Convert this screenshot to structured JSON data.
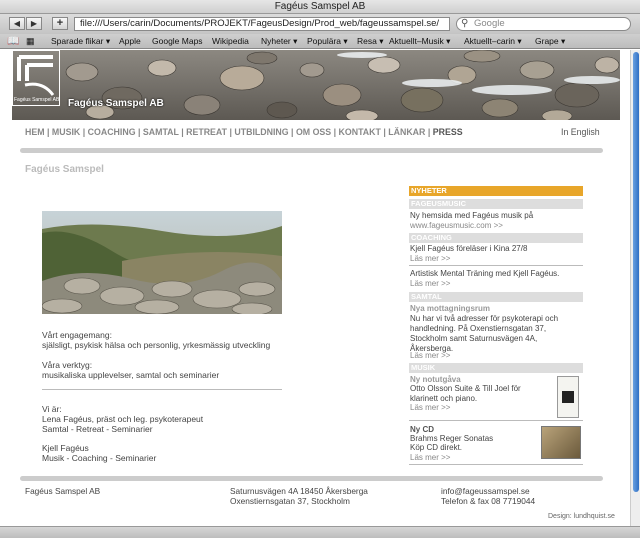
{
  "window": {
    "title": "Fagéus Samspel AB"
  },
  "toolbar": {
    "back": "◀",
    "forward": "▶",
    "add": "+",
    "url": "file:///Users/carin/Documents/PROJEKT/FageusDesign/Prod_web/fageussamspel.se/",
    "search_placeholder": "Google"
  },
  "bookmarks": [
    {
      "label": "Sparade flikar",
      "menu": true
    },
    {
      "label": "Apple",
      "menu": false
    },
    {
      "label": "Google Maps",
      "menu": false
    },
    {
      "label": "Wikipedia",
      "menu": false
    },
    {
      "label": "Nyheter",
      "menu": true
    },
    {
      "label": "Populära",
      "menu": true
    },
    {
      "label": "Resa",
      "menu": true
    },
    {
      "label": "Aktuellt–Musik",
      "menu": true
    },
    {
      "label": "Aktuellt–carin",
      "menu": true
    },
    {
      "label": "Grape",
      "menu": true
    }
  ],
  "banner": {
    "company": "Fagéus Samspel AB",
    "logo_text": "Fagéus Samspel AB"
  },
  "nav": {
    "items": [
      "HEM",
      "MUSIK",
      "COACHING",
      "SAMTAL",
      "RETREAT",
      "UTBILDNING",
      "OM OSS",
      "KONTAKT",
      "LÄNKAR",
      "PRESS"
    ],
    "language": "In English"
  },
  "main": {
    "page_title": "Fagéus Samspel",
    "engagemang_title": "Vårt engagemang:",
    "engagemang_text": "själsligt, psykisk hälsa och personlig, yrkesmässig utveckling",
    "verktyg_title": "Våra verktyg:",
    "verktyg_text": "musikaliska upplevelser, samtal och seminarier",
    "vi_ar": "Vi är:",
    "person1_name": "Lena Fagéus, präst och leg. psykoterapeut",
    "person1_role": "Samtal - Retreat - Seminarier",
    "person2_name": "Kjell Fagéus",
    "person2_role": "Musik - Coaching - Seminarier"
  },
  "sidebar": {
    "nyheter": "NYHETER",
    "fageusmusic": "FAGEUSMUSIC",
    "fm_text": "Ny hemsida med Fagéus musik på",
    "fm_link": "www.fageusmusic.com >>",
    "coaching": "COACHING",
    "c1_text": "Kjell Fagéus föreläser i Kina 27/8",
    "c1_more": "Läs mer >>",
    "c2_text": "Artistisk Mental Träning med Kjell Fagéus.",
    "c2_more": "Läs mer >>",
    "samtal": "SAMTAL",
    "s_sub": "Nya mottagningsrum",
    "s_line1": "Nu har vi två adresser för psykoterapi och",
    "s_line2": "handledning. På Oxenstiernsgatan 37,",
    "s_line3": "Stockholm samt Saturnusvägen 4A,",
    "s_line4": "Åkersberga.",
    "s_more": "Läs mer >>",
    "musik": "MUSIK",
    "m1_sub": "Ny notutgåva",
    "m1_line1": "Otto Olsson Suite & Till Joel för",
    "m1_line2": "klarinett och piano.",
    "m1_more": "Läs mer >>",
    "m2_sub": "Ny CD",
    "m2_line1": "Brahms Reger Sonatas",
    "m2_line2": "Köp CD direkt.",
    "m2_more": "Läs mer >>"
  },
  "footer": {
    "company": "Fagéus Samspel AB",
    "addr1": "Saturnusvägen 4A 18450 Åkersberga",
    "addr2": "Oxenstiernsgatan 37, Stockholm",
    "email": "info@fageussamspel.se",
    "phone": "Telefon & fax 08 7719044",
    "design": "Design: lundhquist.se"
  }
}
